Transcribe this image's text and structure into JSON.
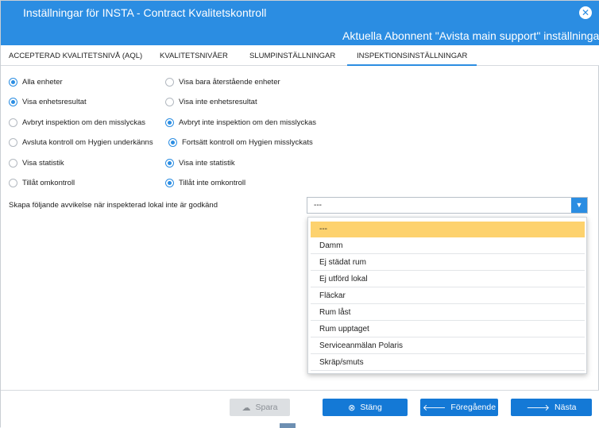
{
  "window": {
    "title": "Inställningar för INSTA - Contract Kvalitetskontroll",
    "subtitle": "Aktuella Abonnent \"Avista main support\" inställningar",
    "close_icon": "close-icon"
  },
  "tabs": [
    {
      "label": "ACCEPTERAD KVALITETSNIVÅ (AQL)",
      "active": false
    },
    {
      "label": "KVALITETSNIVÅER",
      "active": false
    },
    {
      "label": "SLUMPINSTÄLLNINGAR",
      "active": false
    },
    {
      "label": "INSPEKTIONSINSTÄLLNINGAR",
      "active": true
    }
  ],
  "options": [
    {
      "left": {
        "label": "Alla enheter",
        "checked": true
      },
      "right": {
        "label": "Visa bara återstående enheter",
        "checked": false
      }
    },
    {
      "left": {
        "label": "Visa enhetsresultat",
        "checked": true
      },
      "right": {
        "label": "Visa inte enhetsresultat",
        "checked": false
      }
    },
    {
      "left": {
        "label": "Avbryt inspektion om den misslyckas",
        "checked": false
      },
      "right": {
        "label": "Avbryt inte inspektion om den misslyckas",
        "checked": true
      }
    },
    {
      "left": {
        "label": "Avsluta kontroll om Hygien underkänns",
        "checked": false
      },
      "right": {
        "label": "Fortsätt kontroll om Hygien misslyckats",
        "checked": true
      }
    },
    {
      "left": {
        "label": "Visa statistik",
        "checked": false
      },
      "right": {
        "label": "Visa inte statistik",
        "checked": true
      }
    },
    {
      "left": {
        "label": "Tillåt omkontroll",
        "checked": false
      },
      "right": {
        "label": "Tillåt inte omkontroll",
        "checked": true
      }
    }
  ],
  "deviation": {
    "label": "Skapa följande avvikelse när inspekterad lokal inte är godkänd",
    "selected": "---",
    "items": [
      "---",
      "Damm",
      "Ej städat rum",
      "Ej utförd lokal",
      "Fläckar",
      "Rum låst",
      "Rum upptaget",
      "Serviceanmälan Polaris",
      "Skräp/smuts"
    ]
  },
  "footer": {
    "save_label": "Spara",
    "close_label": "Stäng",
    "prev_label": "Föregående",
    "next_label": "Nästa"
  },
  "colors": {
    "accent": "#2b8de2",
    "button": "#1479d6",
    "highlight": "#fdd26e"
  }
}
